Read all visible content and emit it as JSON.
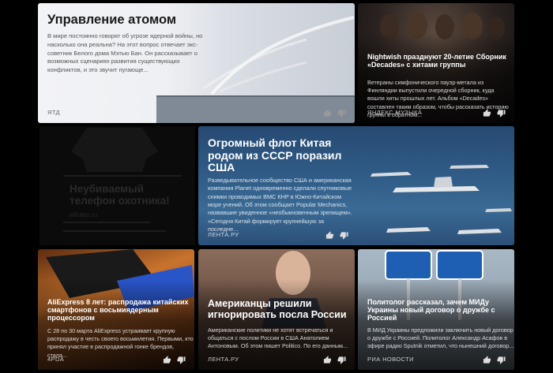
{
  "cards": [
    {
      "title": "Управление атомом",
      "description": "В мире постоянно говорят об угрозе ядерной войны, но насколько она реальна? На этот вопрос отвечает экс-советник Белого дома Мэтью Бан. Он рассказывает о возможных сценариях развития существующих конфликтов, и это звучит пугающе...",
      "source": "ЯТД"
    },
    {
      "title": "Nightwish празднуют 20-летие Сборник «Decades» с хитами группы",
      "description": "Ветераны симфонического пауэр-метала из Финляндии выпустили очередной сборник, куда вошли хиты прошлых лет. Альбом «Decades» составлен таким образом, чтобы рассказать историю группы в обратном...",
      "source": "ЯНДЕКС.МУЗЫКА"
    },
    {
      "title": "Огромный флот Китая родом из СССР поразил США",
      "description": "Разведывательное сообщество США и американская компания Planet одновременно сделали спутниковые снимки проводимых ВМС КНР в Южно-Китайском море учений. Об этом сообщает Popular Mechanics, назвавшие увиденное «необыкновенным зрелищем». «Сегодня Китай формирует крупнейшую за последне...",
      "source": "ЛЕНТА.РУ"
    },
    {
      "title": "AliExpress 8 лет: распродажа китайских смартфонов с восьмиядерным процессором",
      "description": "С 28 по 30 марта AliExpress устраивает крупную распродажу в честь своего восьмилетия. Первыми, кто принял участие в распродажной гонке брендов, стала...",
      "source": "4PDA"
    },
    {
      "title": "Американцы решили игнорировать посла России",
      "description": "Американские политики не хотят встречаться и общаться с послом России в США Анатолием Антоновым. Об этом пишет Politico. По его данным...",
      "source": "ЛЕНТА.РУ"
    },
    {
      "title": "Политолог рассказал, зачем МИДу Украины новый договор о дружбе с Россией",
      "description": "В МИД Украины предложили заключить новый договор о дружбе с Россией. Политолог Александр Асафов в эфире радио Sputnik отметил, что нынешний договор...",
      "source": "РИА НОВОСТИ"
    }
  ],
  "ad": {
    "title": "Неубиваемый телефон охотника!",
    "subtitle": "alibaba.ru"
  },
  "icons": {
    "like": "thumb-up-icon",
    "dislike": "thumb-down-icon"
  }
}
